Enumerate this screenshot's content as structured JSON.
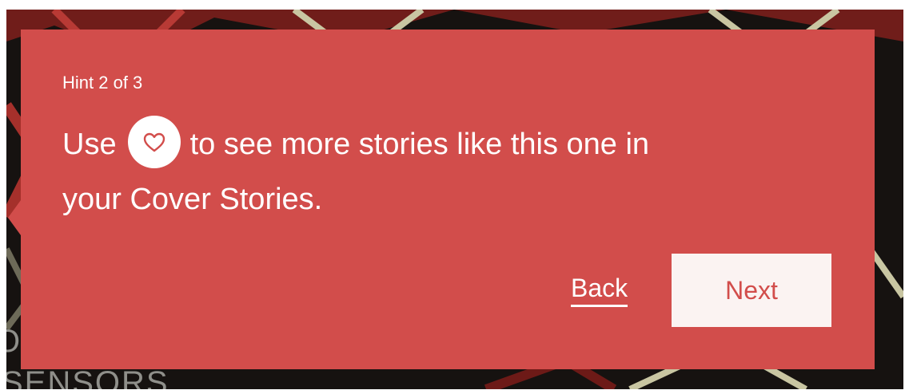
{
  "hint": {
    "counter": "Hint 2 of 3",
    "message_before_icon": "Use",
    "icon": "heart-icon",
    "message_after_icon": "to see more stories like this one in",
    "message_line_2": "your Cover Stories."
  },
  "actions": {
    "back_label": "Back",
    "next_label": "Next"
  },
  "background": {
    "label_bottom": "SENSORS",
    "label_left": "O"
  },
  "colors": {
    "card_background": "#d24d4b",
    "card_text": "#ffffff",
    "next_button_background": "#fbf3f2",
    "next_button_text": "#d24d4b",
    "page_background": "#15120f"
  }
}
